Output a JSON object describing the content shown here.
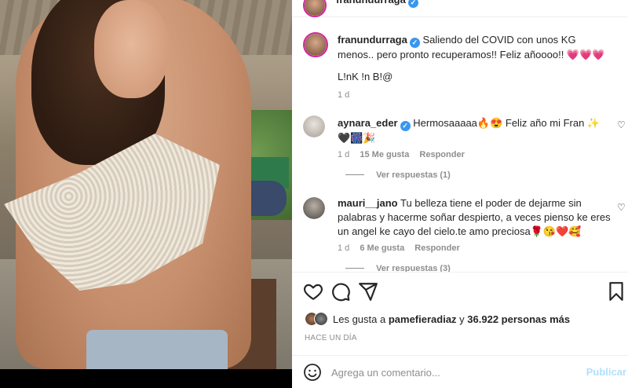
{
  "post": {
    "username": "franundurraga",
    "caption": "Saliendo del COVID con unos KG menos.. pero pronto recuperamos!! Feliz añoooo!! 💗💗💗",
    "caption_line2": "L!nK !n B!@",
    "time": "1 d"
  },
  "comments": [
    {
      "username": "aynara_eder",
      "verified": true,
      "text": "Hermosaaaaa🔥😍 Feliz año mi Fran ✨🖤🎆🎉",
      "time": "1 d",
      "likes": "15 Me gusta",
      "reply": "Responder",
      "view_replies": "Ver respuestas (1)"
    },
    {
      "username": "mauri__jano",
      "verified": false,
      "text": "Tu belleza tiene el poder de dejarme sin palabras y hacerme soñar despierto, a veces pienso ke eres un angel ke cayo del cielo.te amo preciosa🌹😘❤️🥰",
      "time": "1 d",
      "likes": "6 Me gusta",
      "reply": "Responder",
      "view_replies": "Ver respuestas (3)"
    }
  ],
  "likes_line": {
    "prefix": "Les gusta a",
    "user": "pamefieradiaz",
    "middle": "y",
    "count": "36.922 personas más"
  },
  "timestamp": "HACE UN DÍA",
  "comment_box": {
    "placeholder": "Agrega un comentario...",
    "publish_label": "Publicar"
  },
  "icons": [
    "heart-icon",
    "comment-icon",
    "share-icon",
    "bookmark-icon",
    "emoji-icon",
    "verified-icon"
  ],
  "colors": {
    "verified": "#3897f0",
    "publish_disabled": "#b2dffc",
    "meta": "#8e8e8e",
    "story_ring": "#d6249f"
  }
}
